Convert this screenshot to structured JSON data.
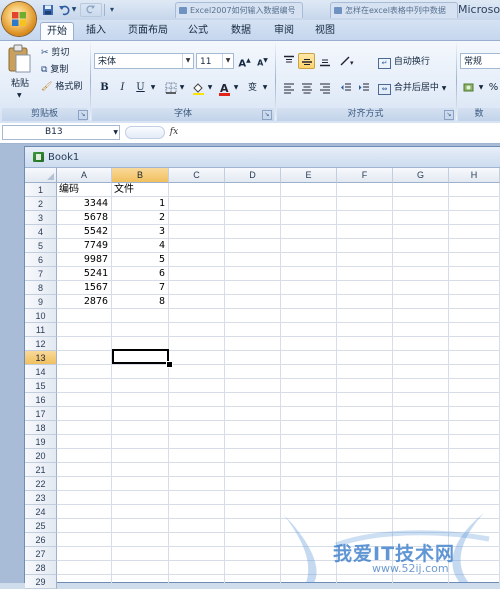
{
  "app": {
    "title": "Microso"
  },
  "quick_access": {
    "save_icon": "save-icon",
    "undo_icon": "undo-icon",
    "redo_icon": "redo-icon"
  },
  "doc_tabs": [
    "Excel2007如何输入数据编号",
    "怎样在excel表格中列中数据"
  ],
  "ribbon_tabs": [
    "开始",
    "插入",
    "页面布局",
    "公式",
    "数据",
    "审阅",
    "视图"
  ],
  "clipboard": {
    "paste": "粘贴",
    "cut": "剪切",
    "copy": "复制",
    "format_painter": "格式刷",
    "group": "剪贴板"
  },
  "font": {
    "name": "宋体",
    "size": "11",
    "bold": "B",
    "italic": "I",
    "underline": "U",
    "grow": "A",
    "shrink": "A",
    "group": "字体"
  },
  "alignment": {
    "wrap_text": "自动换行",
    "merge_center": "合并后居中",
    "group": "对齐方式"
  },
  "number": {
    "format": "常规",
    "percent": "%",
    "group": "数"
  },
  "formula_bar": {
    "name_box": "B13",
    "fx": "fx",
    "value": ""
  },
  "workbook": {
    "name": "Book1"
  },
  "sheet": {
    "columns": [
      "A",
      "B",
      "C",
      "D",
      "E",
      "F",
      "G",
      "H"
    ],
    "rows": [
      "1",
      "2",
      "3",
      "4",
      "5",
      "6",
      "7",
      "8",
      "9",
      "10",
      "11",
      "12",
      "13",
      "14",
      "15",
      "16",
      "17",
      "18",
      "19",
      "20",
      "21",
      "22",
      "23",
      "24",
      "25",
      "26",
      "27",
      "28",
      "29"
    ],
    "headers": [
      "编码",
      "文件"
    ],
    "data": [
      [
        "3344",
        "1"
      ],
      [
        "5678",
        "2"
      ],
      [
        "5542",
        "3"
      ],
      [
        "7749",
        "4"
      ],
      [
        "9987",
        "5"
      ],
      [
        "5241",
        "6"
      ],
      [
        "1567",
        "7"
      ],
      [
        "2876",
        "8"
      ]
    ],
    "active_cell": "B13",
    "selected_column": "B",
    "selected_row": "13"
  },
  "watermark": {
    "text": "我爱IT技术网",
    "url": "www.52ij.com"
  },
  "colors": {
    "accent": "#f1c05e",
    "ribbon": "#dfe9f5",
    "watermark": "#3478c8"
  }
}
